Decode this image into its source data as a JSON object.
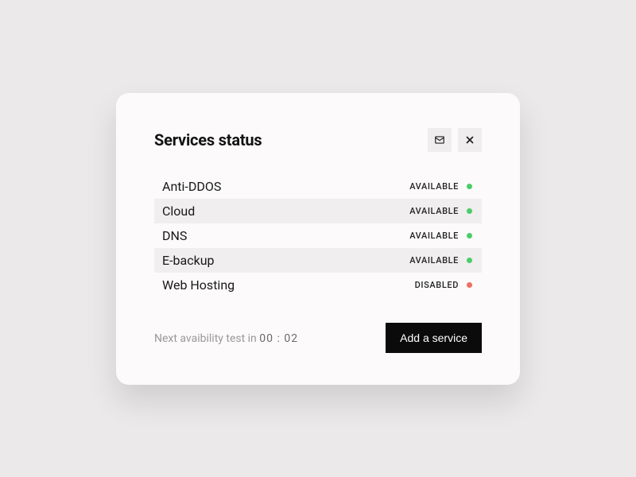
{
  "title": "Services status",
  "services": [
    {
      "name": "Anti-DDOS",
      "status": "AVAILABLE",
      "color": "green"
    },
    {
      "name": "Cloud",
      "status": "AVAILABLE",
      "color": "green"
    },
    {
      "name": "DNS",
      "status": "AVAILABLE",
      "color": "green"
    },
    {
      "name": "E-backup",
      "status": "AVAILABLE",
      "color": "green"
    },
    {
      "name": "Web Hosting",
      "status": "DISABLED",
      "color": "red"
    }
  ],
  "footer": {
    "countdown_label": "Next avaibility test in ",
    "countdown_time": "00 : 02",
    "add_button": "Add a service"
  },
  "icons": {
    "mail": "mail-icon",
    "close": "close-icon"
  }
}
